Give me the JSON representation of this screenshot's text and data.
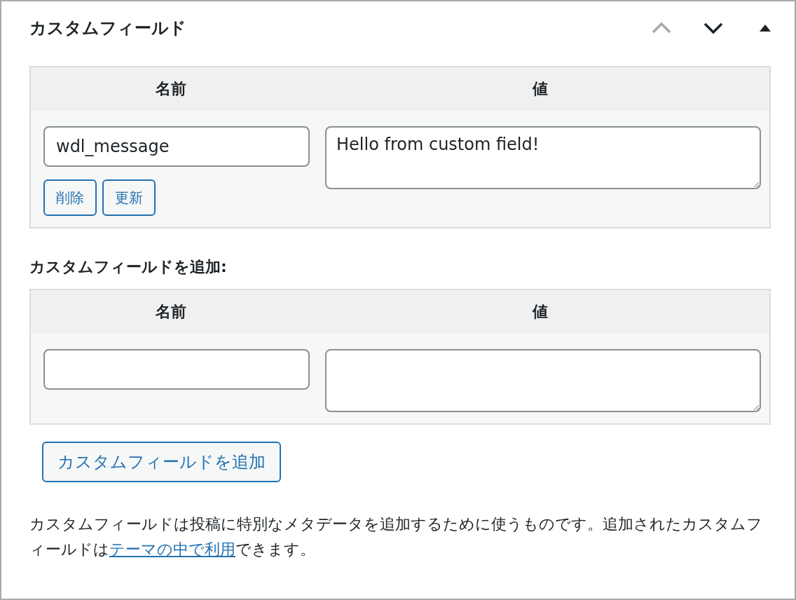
{
  "panel": {
    "title": "カスタムフィールド",
    "header_buttons": [
      {
        "kind": "up",
        "disabled": true
      },
      {
        "kind": "down",
        "disabled": false
      },
      {
        "kind": "toggle",
        "disabled": false
      }
    ]
  },
  "existing": {
    "columns": [
      "名前",
      "値"
    ],
    "rows": [
      {
        "name": "wdl_message",
        "value": "Hello from custom field!",
        "buttons": [
          "削除",
          "更新"
        ]
      }
    ]
  },
  "add": {
    "heading": "カスタムフィールドを追加:",
    "columns": [
      "名前",
      "値"
    ],
    "submit": "カスタムフィールドを追加"
  },
  "description": {
    "before": "カスタムフィールドは投稿に特別なメタデータを追加するために使うものです。追加されたカスタムフィールドは",
    "link": "テーマの中で利用",
    "after": "できます。"
  }
}
